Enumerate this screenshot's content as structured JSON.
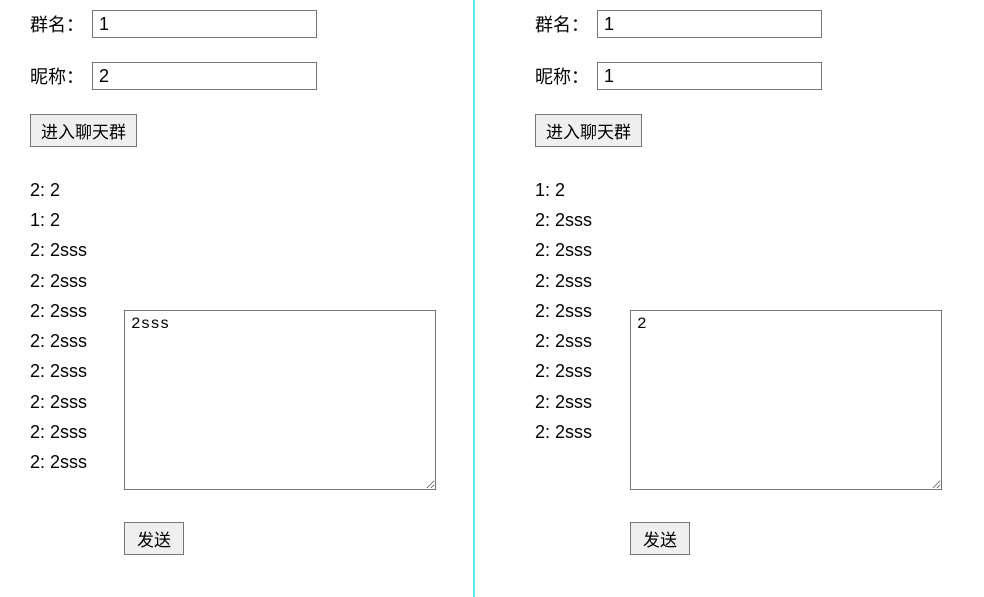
{
  "left": {
    "labels": {
      "group": "群名：",
      "nickname": "昵称："
    },
    "inputs": {
      "group_value": "1",
      "nickname_value": "2"
    },
    "enter_button_label": "进入聊天群",
    "messages": [
      "2: 2",
      "1: 2",
      "2: 2sss",
      "2: 2sss",
      "2: 2sss",
      "2: 2sss",
      "2: 2sss",
      "2: 2sss",
      "2: 2sss",
      "2: 2sss"
    ],
    "compose_value": "2sss",
    "send_button_label": "发送"
  },
  "right": {
    "labels": {
      "group": "群名：",
      "nickname": "昵称："
    },
    "inputs": {
      "group_value": "1",
      "nickname_value": "1"
    },
    "enter_button_label": "进入聊天群",
    "messages": [
      "1: 2",
      "2: 2sss",
      "2: 2sss",
      "2: 2sss",
      "2: 2sss",
      "2: 2sss",
      "2: 2sss",
      "2: 2sss",
      "2: 2sss"
    ],
    "compose_value": "2",
    "send_button_label": "发送"
  }
}
